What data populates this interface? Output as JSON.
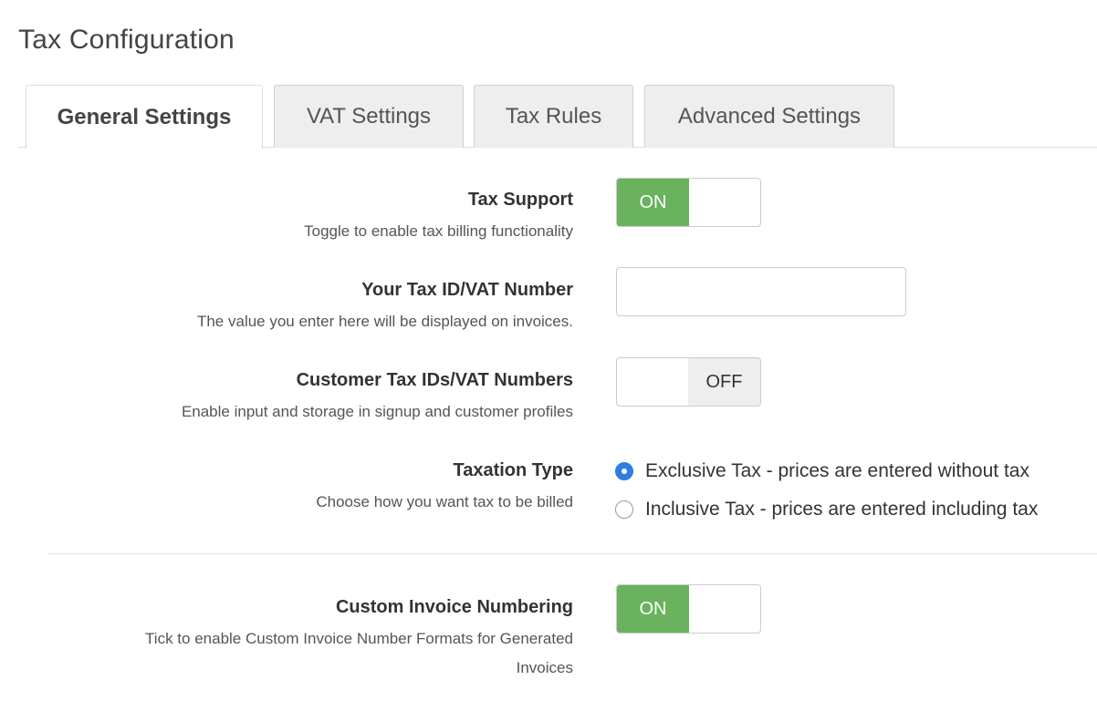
{
  "page": {
    "title": "Tax Configuration"
  },
  "tabs": [
    {
      "label": "General Settings",
      "active": true
    },
    {
      "label": "VAT Settings",
      "active": false
    },
    {
      "label": "Tax Rules",
      "active": false
    },
    {
      "label": "Advanced Settings",
      "active": false
    }
  ],
  "settings": {
    "tax_support": {
      "label": "Tax Support",
      "help": "Toggle to enable tax billing functionality",
      "state": "ON"
    },
    "tax_id": {
      "label": "Your Tax ID/VAT Number",
      "help": "The value you enter here will be displayed on invoices.",
      "value": ""
    },
    "customer_tax_ids": {
      "label": "Customer Tax IDs/VAT Numbers",
      "help": "Enable input and storage in signup and customer profiles",
      "state": "OFF"
    },
    "taxation_type": {
      "label": "Taxation Type",
      "help": "Choose how you want tax to be billed",
      "options": [
        {
          "label": "Exclusive Tax - prices are entered without tax",
          "checked": true
        },
        {
          "label": "Inclusive Tax - prices are entered including tax",
          "checked": false
        }
      ]
    },
    "custom_invoice_numbering": {
      "label": "Custom Invoice Numbering",
      "help_line1": "Tick to enable Custom Invoice Number Formats for Generated",
      "help_line2": "Invoices",
      "state": "ON"
    }
  },
  "colors": {
    "toggle_on": "#6ab25e",
    "toggle_off_bg": "#eeeeee",
    "radio_checked": "#2f7de1"
  }
}
